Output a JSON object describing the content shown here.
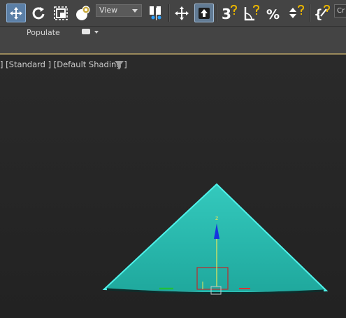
{
  "toolbar": {
    "view_dropdown": "View",
    "create_field": "Cr",
    "tools": [
      {
        "name": "select-and-move",
        "icon": "move-icon",
        "active": true
      },
      {
        "name": "select-and-rotate",
        "icon": "rotate-icon"
      },
      {
        "name": "select-and-scale",
        "icon": "scale-icon"
      },
      {
        "name": "select-and-place",
        "icon": "place-icon"
      },
      {
        "name": "reference-coordinate-system",
        "icon": "view-dropdown"
      },
      {
        "name": "use-pivot-center",
        "icon": "pivot-icon"
      },
      {
        "name": "select-manipulate",
        "icon": "manipulate-icon"
      },
      {
        "name": "keyboard-shortcut-override",
        "icon": "keyboard-override-icon",
        "active": true
      },
      {
        "name": "snaps-toggle",
        "icon": "snap-3d-icon",
        "label": "3"
      },
      {
        "name": "angle-snap",
        "icon": "angle-snap-icon"
      },
      {
        "name": "percent-snap",
        "icon": "percent-snap-icon",
        "label": "%"
      },
      {
        "name": "spinner-snap",
        "icon": "spinner-snap-icon"
      },
      {
        "name": "edit-named-selection",
        "icon": "named-selection-icon"
      }
    ]
  },
  "ribbon": {
    "tab_label": "Populate"
  },
  "viewport": {
    "label_parts": [
      "] ",
      "[Standard ] ",
      "[Default Shading ]"
    ],
    "gizmo_axis_label": "z",
    "object_color": "#2bbdb3",
    "selection_color": "#3fe8e0",
    "axis_colors": {
      "z": "#1030e0",
      "y": "#20c020",
      "x": "#e03030",
      "box": "#cc2a2a"
    }
  }
}
